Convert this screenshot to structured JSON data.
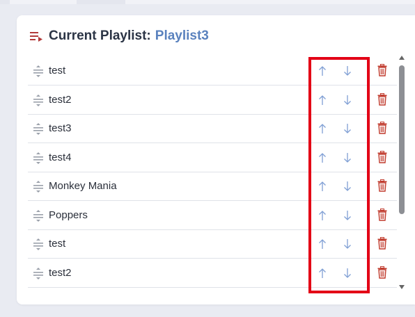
{
  "header": {
    "title": "Current Playlist:",
    "playlist_name": "Playlist3",
    "icon": "playlist-play-icon"
  },
  "colors": {
    "accent": "#5a82be",
    "title": "#2b3445",
    "delete": "#c0392b",
    "highlight": "#e30016",
    "arrow": "#7f9fd4"
  },
  "playlist": {
    "items": [
      {
        "label": "test"
      },
      {
        "label": "test2"
      },
      {
        "label": "test3"
      },
      {
        "label": "test4"
      },
      {
        "label": "Monkey Mania"
      },
      {
        "label": "Poppers"
      },
      {
        "label": "test"
      },
      {
        "label": "test2"
      }
    ],
    "row_icons": {
      "drag": "drag-handle-icon",
      "up": "arrow-up-icon",
      "down": "arrow-down-icon",
      "delete": "trash-icon"
    }
  }
}
